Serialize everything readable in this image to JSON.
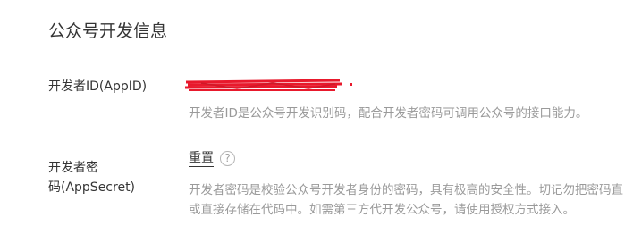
{
  "section": {
    "title": "公众号开发信息"
  },
  "appid": {
    "label": "开发者ID(AppID)",
    "description": "开发者ID是公众号开发识别码，配合开发者密码可调用公众号的接口能力。"
  },
  "secret": {
    "label_line1": "开发者密",
    "label_line2": "码(AppSecret)",
    "reset_label": "重置",
    "help_icon": "question-circle-icon",
    "description_line1": "开发者密码是校验公众号开发者身份的密码，具有极高的安全性。切记勿把密码直",
    "description_line2": "或直接存储在代码中。如需第三方代开发公众号，请使用授权方式接入。"
  },
  "colors": {
    "text": "#353535",
    "muted": "#9a9a9a",
    "redaction": "#e8192c"
  }
}
